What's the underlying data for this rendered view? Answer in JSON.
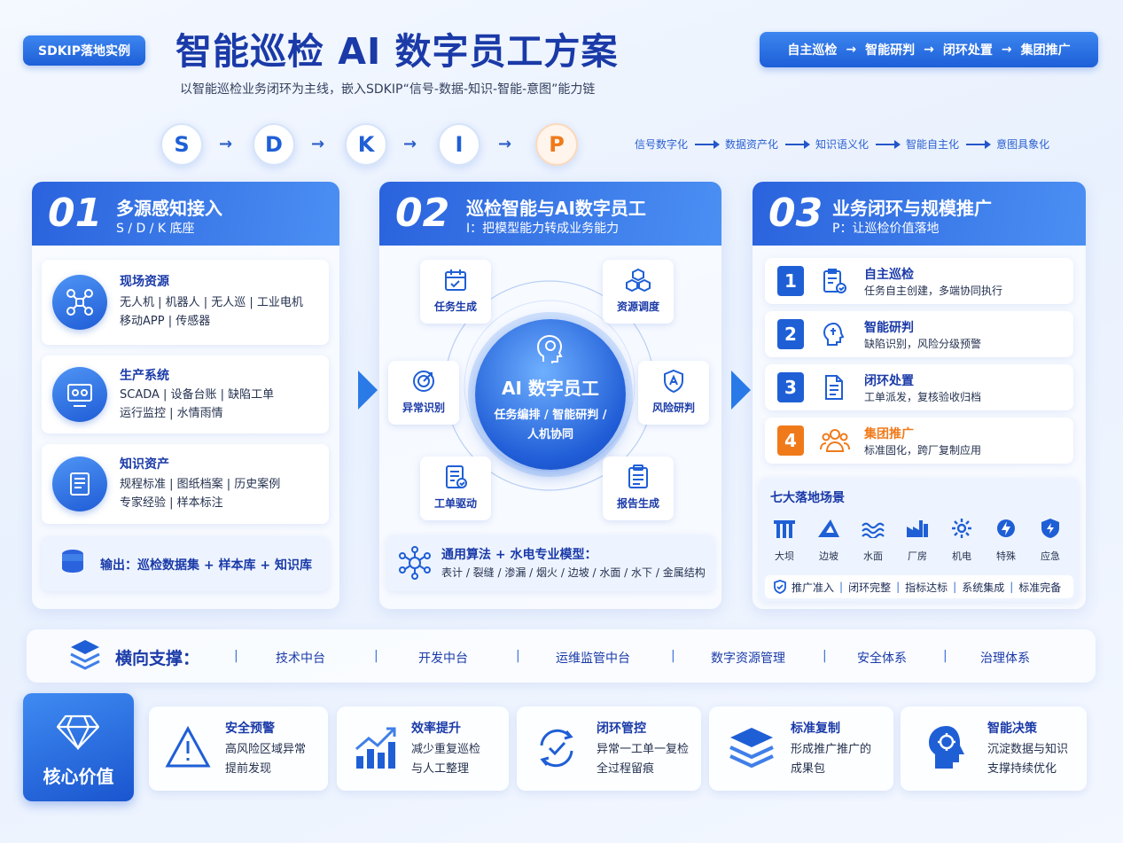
{
  "header": {
    "badge": "SDKIP落地实例",
    "title": "智能巡检 AI 数字员工方案",
    "subtitle": "以智能巡检业务闭环为主线，嵌入SDKIP“信号-数据-知识-智能-意图”能力链",
    "flow": [
      "自主巡检",
      "智能研判",
      "闭环处置",
      "集团推广"
    ],
    "flow_arrow": "→"
  },
  "sdkip": {
    "letters": [
      "S",
      "D",
      "K",
      "I",
      "P"
    ],
    "arrow": "→",
    "chain": [
      "信号数字化",
      "数据资产化",
      "知识语义化",
      "智能自主化",
      "意图具象化"
    ]
  },
  "col1": {
    "num": "01",
    "title": "多源感知接入",
    "sub": "S / D / K 底座",
    "cards": [
      {
        "title": "现场资源",
        "lines": [
          "无人机 | 机器人 | 无人巡 | 工业电机",
          "移动APP | 传感器"
        ],
        "icon": "drone-icon"
      },
      {
        "title": "生产系统",
        "lines": [
          "SCADA | 设备台账 | 缺陷工单",
          "运行监控 | 水情雨情"
        ],
        "icon": "monitor-icon"
      },
      {
        "title": "知识资产",
        "lines": [
          "规程标准 | 图纸档案 | 历史案例",
          "专家经验 | 样本标注"
        ],
        "icon": "book-icon"
      }
    ],
    "output": "输出：巡检数据集 + 样本库 + 知识库"
  },
  "col2": {
    "num": "02",
    "title": "巡检智能与AI数字员工",
    "sub": "I：把模型能力转成业务能力",
    "center_title": "AI 数字员工",
    "center_sub": [
      "任务编排 / 智能研判 /",
      "人机协同"
    ],
    "modules": [
      "任务生成",
      "资源调度",
      "异常识别",
      "风险研判",
      "工单驱动",
      "报告生成"
    ],
    "algo_title": "通用算法 + 水电专业模型：",
    "algo_text": "表计 / 裂缝 / 渗漏 / 烟火 / 边坡 / 水面 / 水下 / 金属结构"
  },
  "col3": {
    "num": "03",
    "title": "业务闭环与规模推广",
    "sub": "P：让巡检价值落地",
    "steps": [
      {
        "n": "1",
        "title": "自主巡检",
        "text": "任务自主创建，多端协同执行"
      },
      {
        "n": "2",
        "title": "智能研判",
        "text": "缺陷识别，风险分级预警"
      },
      {
        "n": "3",
        "title": "闭环处置",
        "text": "工单派发，复核验收归档"
      },
      {
        "n": "4",
        "title": "集团推广",
        "text": "标准固化，跨厂复制应用"
      }
    ],
    "scenes_title": "七大落地场景",
    "scenes": [
      "大坝",
      "边坡",
      "水面",
      "厂房",
      "机电",
      "特殊",
      "应急"
    ],
    "criteria": [
      "推广准入",
      "闭环完整",
      "指标达标",
      "系统集成",
      "标准完备"
    ]
  },
  "support": {
    "title": "横向支撑：",
    "items": [
      "技术中台",
      "开发中台",
      "运维监管中台",
      "数字资源管理",
      "安全体系",
      "治理体系"
    ]
  },
  "values": {
    "title": "核心价值",
    "items": [
      {
        "title": "安全预警",
        "lines": [
          "高风险区域异常",
          "提前发现"
        ]
      },
      {
        "title": "效率提升",
        "lines": [
          "减少重复巡检",
          "与人工整理"
        ]
      },
      {
        "title": "闭环管控",
        "lines": [
          "异常一工单一复检",
          "全过程留痕"
        ]
      },
      {
        "title": "标准复制",
        "lines": [
          "形成推广推广的",
          "成果包"
        ]
      },
      {
        "title": "智能决策",
        "lines": [
          "沉淀数据与知识",
          "支撑持续优化"
        ]
      }
    ]
  },
  "colors": {
    "primary": "#1f5fd6",
    "accent": "#f07a1a"
  }
}
